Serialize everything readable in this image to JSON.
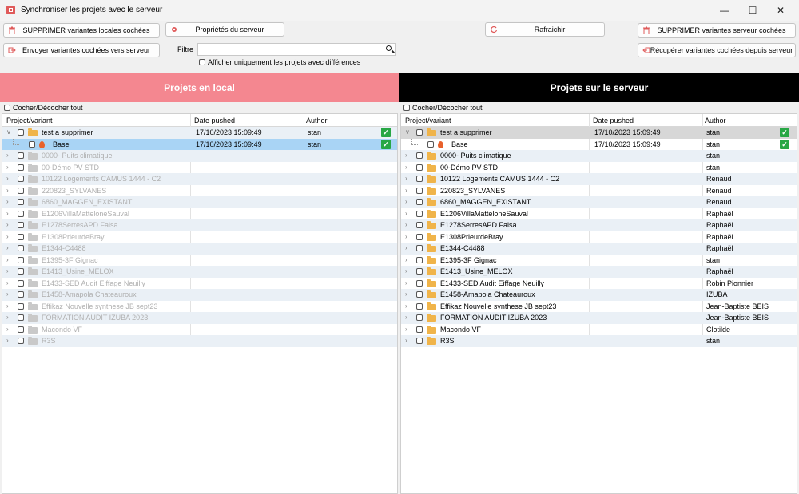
{
  "window": {
    "title": "Synchroniser les projets avec le serveur",
    "minimize": "—",
    "maximize": "☐",
    "close": "✕"
  },
  "toolbar": {
    "delete_local": "SUPPRIMER variantes locales cochées",
    "server_props": "Propriétés du serveur",
    "refresh": "Rafraichir",
    "delete_server": "SUPPRIMER variantes serveur cochées",
    "send": "Envoyer variantes cochées vers serveur",
    "fetch": "Récupérer variantes cochées depuis serveur",
    "filter_label": "Filtre",
    "filter_value": "",
    "diff_only": "Afficher uniquement les projets avec différences"
  },
  "colors": {
    "local_header": "#f48790",
    "server_header": "#000000",
    "selected_row": "#a9d4f5",
    "ok": "#28a745"
  },
  "local": {
    "header": "Projets en local",
    "check_all": "Cocher/Décocher tout",
    "columns": [
      "Project/variant",
      "Date pushed",
      "Author"
    ],
    "rows": [
      {
        "name": "test a supprimer",
        "date": "17/10/2023 15:09:49",
        "author": "stan",
        "level": 0,
        "expanded": true,
        "ok": true
      },
      {
        "name": "Base",
        "date": "17/10/2023 15:09:49",
        "author": "stan",
        "level": 1,
        "ok": true
      },
      {
        "name": "0000- Puits climatique",
        "date": "",
        "author": "",
        "level": 0
      },
      {
        "name": "00-Démo PV STD",
        "date": "",
        "author": "",
        "level": 0
      },
      {
        "name": "10122 Logements CAMUS 1444 - C2",
        "date": "",
        "author": "",
        "level": 0
      },
      {
        "name": "220823_SYLVANES",
        "date": "",
        "author": "",
        "level": 0
      },
      {
        "name": "6860_MAGGEN_EXISTANT",
        "date": "",
        "author": "",
        "level": 0
      },
      {
        "name": "E1206VillaMatteloneSauval",
        "date": "",
        "author": "",
        "level": 0
      },
      {
        "name": "E1278SerresAPD Faisa",
        "date": "",
        "author": "",
        "level": 0
      },
      {
        "name": "E1308PrieurdeBray",
        "date": "",
        "author": "",
        "level": 0
      },
      {
        "name": "E1344-C4488",
        "date": "",
        "author": "",
        "level": 0
      },
      {
        "name": "E1395-3F Gignac",
        "date": "",
        "author": "",
        "level": 0
      },
      {
        "name": "E1413_Usine_MELOX",
        "date": "",
        "author": "",
        "level": 0
      },
      {
        "name": "E1433-SED Audit Eiffage Neuilly",
        "date": "",
        "author": "",
        "level": 0
      },
      {
        "name": "E1458-Amapola Chateauroux",
        "date": "",
        "author": "",
        "level": 0
      },
      {
        "name": "Effikaz Nouvelle synthese JB sept23",
        "date": "",
        "author": "",
        "level": 0
      },
      {
        "name": "FORMATION AUDIT IZUBA 2023",
        "date": "",
        "author": "",
        "level": 0
      },
      {
        "name": "Macondo VF",
        "date": "",
        "author": "",
        "level": 0
      },
      {
        "name": "R3S",
        "date": "",
        "author": "",
        "level": 0
      }
    ]
  },
  "server": {
    "header": "Projets sur le serveur",
    "check_all": "Cocher/Décocher tout",
    "columns": [
      "Project/variant",
      "Date pushed",
      "Author"
    ],
    "rows": [
      {
        "name": "test a supprimer",
        "date": "17/10/2023 15:09:49",
        "author": "stan",
        "level": 0,
        "expanded": true,
        "ok": true
      },
      {
        "name": "Base",
        "date": "17/10/2023 15:09:49",
        "author": "stan",
        "level": 1,
        "ok": true
      },
      {
        "name": "0000- Puits climatique",
        "date": "",
        "author": "stan",
        "level": 0
      },
      {
        "name": "00-Démo PV STD",
        "date": "",
        "author": "stan",
        "level": 0
      },
      {
        "name": "10122 Logements CAMUS 1444 - C2",
        "date": "",
        "author": "Renaud",
        "level": 0
      },
      {
        "name": "220823_SYLVANES",
        "date": "",
        "author": "Renaud",
        "level": 0
      },
      {
        "name": "6860_MAGGEN_EXISTANT",
        "date": "",
        "author": "Renaud",
        "level": 0
      },
      {
        "name": "E1206VillaMatteloneSauval",
        "date": "",
        "author": "Raphaël",
        "level": 0
      },
      {
        "name": "E1278SerresAPD Faisa",
        "date": "",
        "author": "Raphaël",
        "level": 0
      },
      {
        "name": "E1308PrieurdeBray",
        "date": "",
        "author": "Raphaël",
        "level": 0
      },
      {
        "name": "E1344-C4488",
        "date": "",
        "author": "Raphaël",
        "level": 0
      },
      {
        "name": "E1395-3F Gignac",
        "date": "",
        "author": "stan",
        "level": 0
      },
      {
        "name": "E1413_Usine_MELOX",
        "date": "",
        "author": "Raphaël",
        "level": 0
      },
      {
        "name": "E1433-SED Audit Eiffage Neuilly",
        "date": "",
        "author": "Robin Pionnier",
        "level": 0
      },
      {
        "name": "E1458-Amapola Chateauroux",
        "date": "",
        "author": "IZUBA",
        "level": 0
      },
      {
        "name": "Effikaz Nouvelle synthese JB sept23",
        "date": "",
        "author": "Jean-Baptiste BEIS",
        "level": 0
      },
      {
        "name": "FORMATION AUDIT IZUBA 2023",
        "date": "",
        "author": "Jean-Baptiste BEIS",
        "level": 0
      },
      {
        "name": "Macondo VF",
        "date": "",
        "author": "Clotilde",
        "level": 0
      },
      {
        "name": "R3S",
        "date": "",
        "author": "stan",
        "level": 0
      }
    ]
  }
}
